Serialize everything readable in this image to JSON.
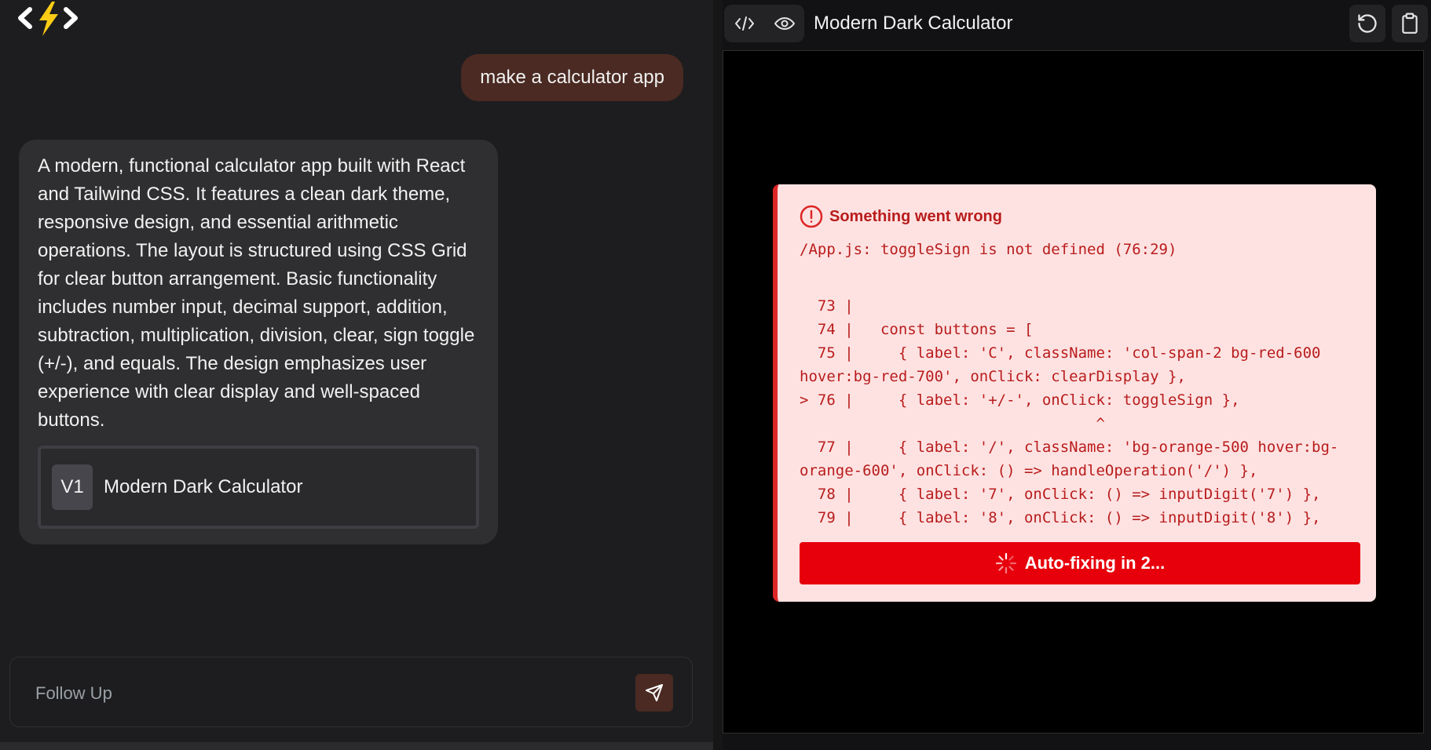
{
  "chat": {
    "user_message": "make a calculator app",
    "assistant_message": "A modern, functional calculator app built with React and Tailwind CSS. It features a clean dark theme, responsive design, and essential arithmetic operations. The layout is structured using CSS Grid for clear button arrangement. Basic functionality includes number input, decimal support, addition, subtraction, multiplication, division, clear, sign toggle (+/-), and equals. The design emphasizes user experience with clear display and well-spaced buttons.",
    "artifact": {
      "version": "V1",
      "title": "Modern Dark Calculator"
    },
    "followup_placeholder": "Follow Up"
  },
  "preview": {
    "title": "Modern Dark Calculator",
    "error": {
      "title": "Something went wrong",
      "message": "/App.js: toggleSign is not defined (76:29)",
      "code": "  73 |\n  74 |   const buttons = [\n  75 |     { label: 'C', className: 'col-span-2 bg-red-600\nhover:bg-red-700', onClick: clearDisplay },\n> 76 |     { label: '+/-', onClick: toggleSign },\n                                 ^\n  77 |     { label: '/', className: 'bg-orange-500 hover:bg-\norange-600', onClick: () => handleOperation('/') },\n  78 |     { label: '7', onClick: () => inputDigit('7') },\n  79 |     { label: '8', onClick: () => inputDigit('8') },",
      "autofix_label": "Auto-fixing in 2..."
    }
  },
  "icons": {
    "logo": "code-bolt-logo",
    "send": "send-icon",
    "code_view": "code-icon",
    "preview_view": "eye-icon",
    "refresh": "refresh-icon",
    "copy": "clipboard-icon",
    "error": "alert-circle-icon",
    "spinner": "spinner-icon"
  },
  "colors": {
    "accent_brown": "#4a2a22",
    "error_red": "#e7000b",
    "error_bg": "#fee2e2",
    "bolt_yellow": "#facc15"
  }
}
